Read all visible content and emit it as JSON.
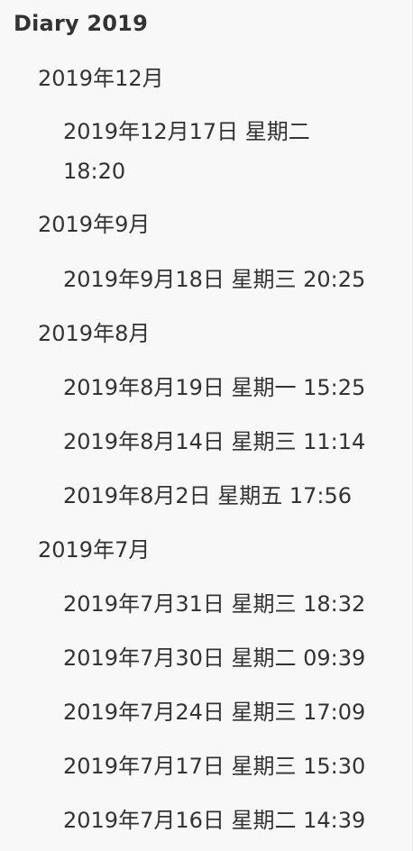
{
  "root": {
    "title": "Diary 2019"
  },
  "months": [
    {
      "label": "2019年12月",
      "entries": [
        "2019年12月17日 星期二 18:20"
      ]
    },
    {
      "label": "2019年9月",
      "entries": [
        "2019年9月18日 星期三 20:25"
      ]
    },
    {
      "label": "2019年8月",
      "entries": [
        "2019年8月19日 星期一 15:25",
        "2019年8月14日 星期三 11:14",
        "2019年8月2日 星期五 17:56"
      ]
    },
    {
      "label": "2019年7月",
      "entries": [
        "2019年7月31日 星期三 18:32",
        "2019年7月30日 星期二 09:39",
        "2019年7月24日 星期三 17:09",
        "2019年7月17日 星期三 15:30",
        "2019年7月16日 星期二 14:39"
      ]
    }
  ]
}
